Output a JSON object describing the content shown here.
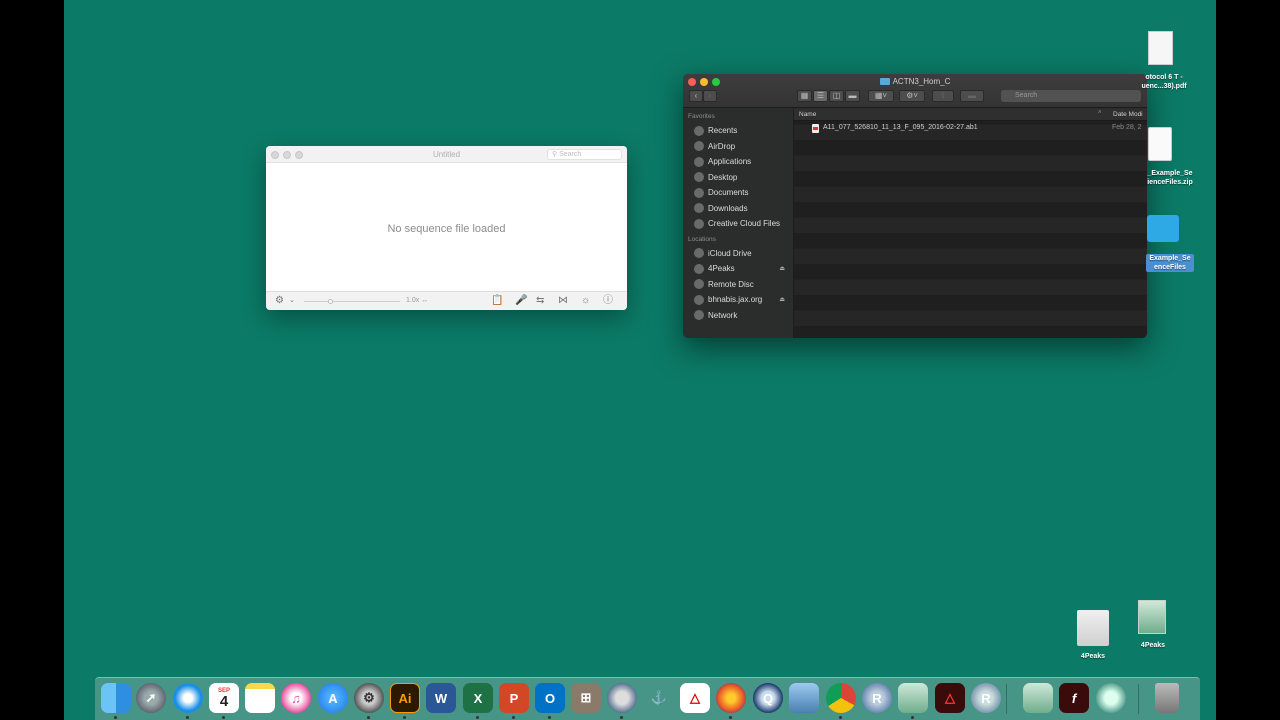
{
  "sequence_window": {
    "title": "Untitled",
    "search_placeholder": "Search",
    "empty_message": "No sequence file loaded",
    "zoom": "1.0x"
  },
  "finder": {
    "title": "ACTN3_Hom_C",
    "search_placeholder": "Search",
    "sidebar": {
      "favorites_header": "Favorites",
      "favorites": [
        {
          "label": "Recents",
          "icon": "clock-icon"
        },
        {
          "label": "AirDrop",
          "icon": "airdrop-icon"
        },
        {
          "label": "Applications",
          "icon": "applications-icon"
        },
        {
          "label": "Desktop",
          "icon": "desktop-icon"
        },
        {
          "label": "Documents",
          "icon": "documents-icon"
        },
        {
          "label": "Downloads",
          "icon": "downloads-icon"
        },
        {
          "label": "Creative Cloud Files",
          "icon": "creative-cloud-icon"
        }
      ],
      "locations_header": "Locations",
      "locations": [
        {
          "label": "iCloud Drive",
          "icon": "cloud-icon"
        },
        {
          "label": "4Peaks",
          "icon": "drive-icon",
          "eject": true
        },
        {
          "label": "Remote Disc",
          "icon": "disc-icon"
        },
        {
          "label": "bhnabis.jax.org",
          "icon": "server-icon",
          "eject": true
        },
        {
          "label": "Network",
          "icon": "network-icon"
        }
      ]
    },
    "columns": {
      "name": "Name",
      "date": "Date Modi"
    },
    "files": [
      {
        "name": "A11_077_526810_11_13_F_095_2016-02-27.ab1",
        "date": "Feb 28, 2"
      }
    ]
  },
  "desktop": {
    "icons": [
      {
        "label_line1": "otocol 6 T -",
        "label_line2": "uenc...38).pdf"
      },
      {
        "label_line1": "_Example_Se",
        "label_line2": "ienceFiles.zip"
      },
      {
        "label_line1": "Example_Se",
        "label_line2": "enceFiles"
      },
      {
        "label": "4Peaks"
      },
      {
        "label": "4Peaks"
      }
    ]
  },
  "dock": {
    "calendar_month": "SEP",
    "calendar_day": "4",
    "items": [
      "finder",
      "launchpad",
      "safari",
      "calendar",
      "notes",
      "itunes",
      "app-store",
      "system-preferences",
      "illustrator",
      "word",
      "excel",
      "powerpoint",
      "outlook",
      "calculator",
      "gimp",
      "gimp-alt",
      "acrobat",
      "firefox",
      "quicktime",
      "preview",
      "chrome",
      "r",
      "4peaks",
      "acrobat-dc",
      "rstudio",
      "4peaks-doc",
      "flash",
      "safari-alt",
      "trash"
    ],
    "labels": {
      "illustrator": "Ai",
      "word": "W",
      "excel": "X",
      "powerpoint": "P",
      "outlook": "O",
      "r": "R",
      "flash": "f"
    }
  }
}
